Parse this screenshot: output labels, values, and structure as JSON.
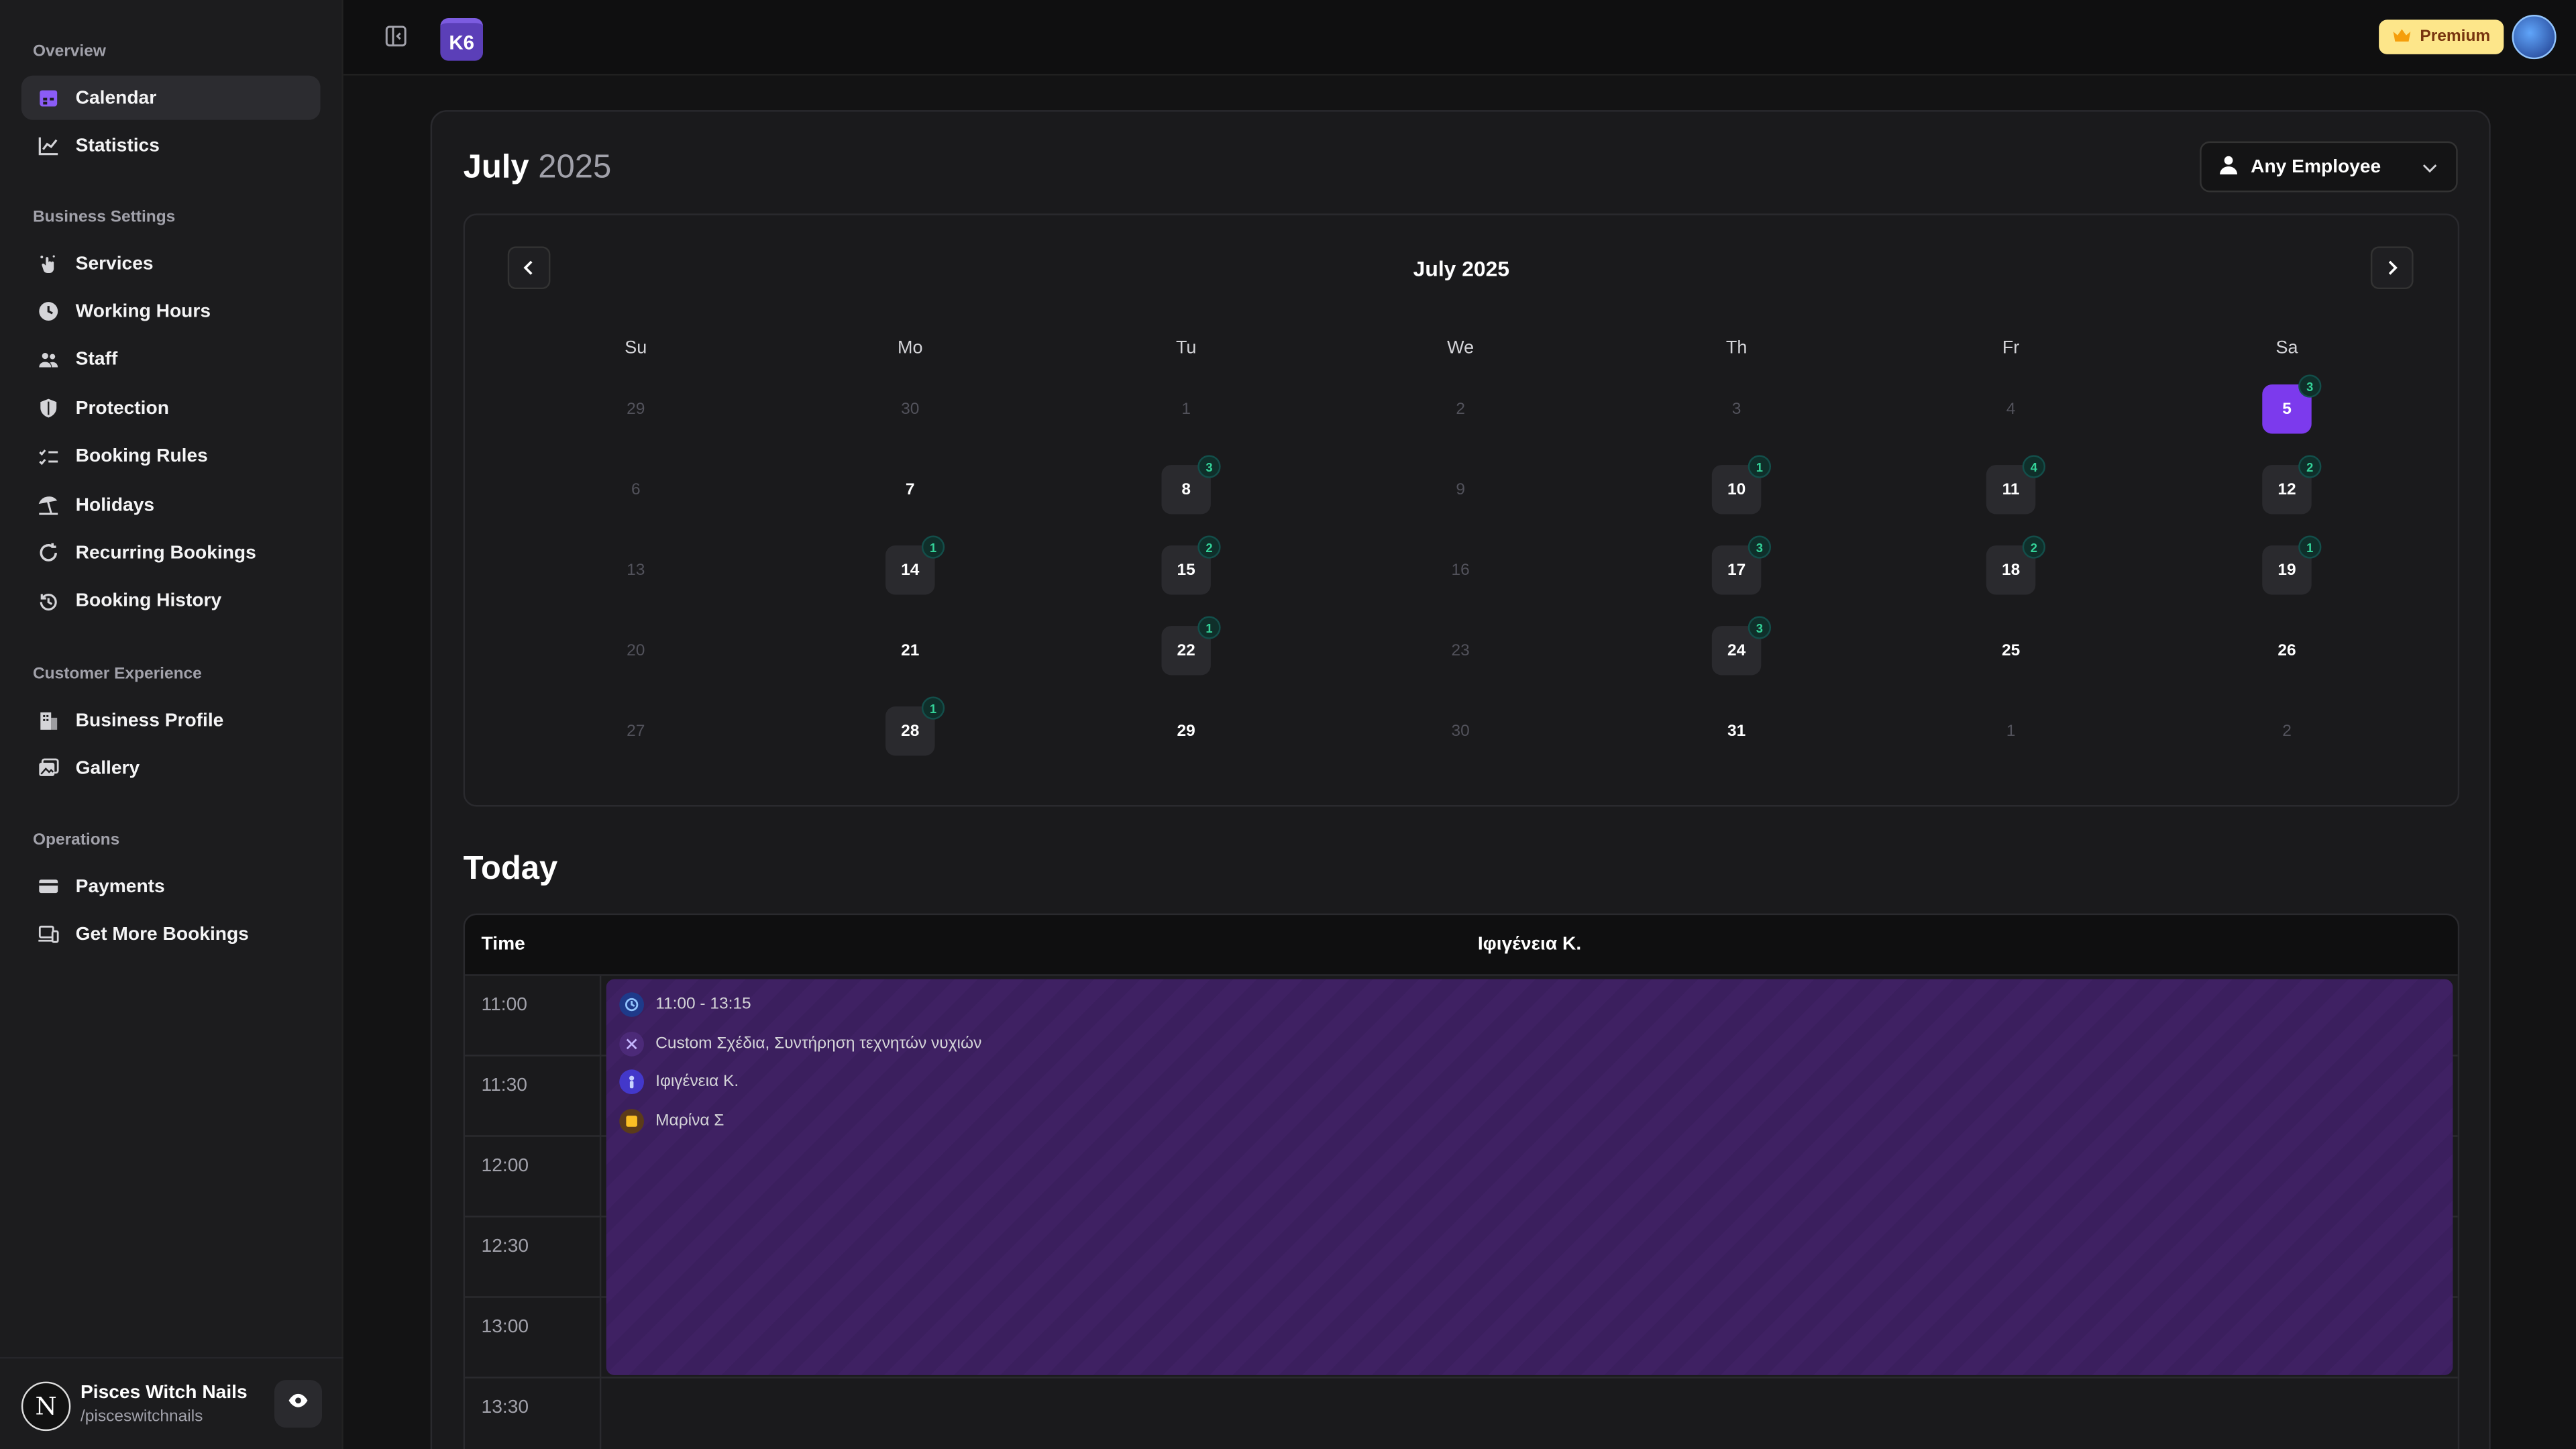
{
  "sidebar": {
    "sections": [
      {
        "heading": "Overview",
        "items": [
          {
            "label": "Calendar",
            "icon": "calendar-icon",
            "active": true
          },
          {
            "label": "Statistics",
            "icon": "chart-icon"
          }
        ]
      },
      {
        "heading": "Business Settings",
        "items": [
          {
            "label": "Services",
            "icon": "hand-sparkle-icon"
          },
          {
            "label": "Working Hours",
            "icon": "clock-icon"
          },
          {
            "label": "Staff",
            "icon": "users-icon"
          },
          {
            "label": "Protection",
            "icon": "shield-icon"
          },
          {
            "label": "Booking Rules",
            "icon": "list-check-icon"
          },
          {
            "label": "Holidays",
            "icon": "beach-icon"
          },
          {
            "label": "Recurring Bookings",
            "icon": "refresh-icon"
          },
          {
            "label": "Booking History",
            "icon": "history-icon"
          }
        ]
      },
      {
        "heading": "Customer Experience",
        "items": [
          {
            "label": "Business Profile",
            "icon": "building-icon"
          },
          {
            "label": "Gallery",
            "icon": "gallery-icon"
          }
        ]
      },
      {
        "heading": "Operations",
        "items": [
          {
            "label": "Payments",
            "icon": "credit-card-icon"
          },
          {
            "label": "Get More Bookings",
            "icon": "device-icon"
          }
        ]
      }
    ],
    "business": {
      "name": "Pisces Witch Nails",
      "handle": "/pisceswitchnails",
      "avatar_letter": "N"
    }
  },
  "topbar": {
    "logo_text": "K6",
    "premium_label": "Premium"
  },
  "page": {
    "month": "July",
    "year": "2025",
    "employee_select": "Any Employee"
  },
  "calendar": {
    "title": "July 2025",
    "weekdays": [
      "Su",
      "Mo",
      "Tu",
      "We",
      "Th",
      "Fr",
      "Sa"
    ],
    "weeks": [
      [
        {
          "d": "29",
          "muted": true
        },
        {
          "d": "30",
          "muted": true
        },
        {
          "d": "1",
          "muted": true
        },
        {
          "d": "2",
          "muted": true
        },
        {
          "d": "3",
          "muted": true
        },
        {
          "d": "4",
          "muted": true
        },
        {
          "d": "5",
          "selected": true,
          "count": "3"
        }
      ],
      [
        {
          "d": "6",
          "muted": true
        },
        {
          "d": "7"
        },
        {
          "d": "8",
          "count": "3"
        },
        {
          "d": "9",
          "muted": true
        },
        {
          "d": "10",
          "count": "1"
        },
        {
          "d": "11",
          "count": "4"
        },
        {
          "d": "12",
          "count": "2"
        }
      ],
      [
        {
          "d": "13",
          "muted": true
        },
        {
          "d": "14",
          "count": "1"
        },
        {
          "d": "15",
          "count": "2"
        },
        {
          "d": "16",
          "muted": true
        },
        {
          "d": "17",
          "count": "3"
        },
        {
          "d": "18",
          "count": "2"
        },
        {
          "d": "19",
          "count": "1"
        }
      ],
      [
        {
          "d": "20",
          "muted": true
        },
        {
          "d": "21"
        },
        {
          "d": "22",
          "count": "1"
        },
        {
          "d": "23",
          "muted": true
        },
        {
          "d": "24",
          "count": "3"
        },
        {
          "d": "25"
        },
        {
          "d": "26"
        }
      ],
      [
        {
          "d": "27",
          "muted": true
        },
        {
          "d": "28",
          "count": "1"
        },
        {
          "d": "29"
        },
        {
          "d": "30",
          "muted": true
        },
        {
          "d": "31"
        },
        {
          "d": "1",
          "muted": true
        },
        {
          "d": "2",
          "muted": true
        }
      ]
    ]
  },
  "today": {
    "title": "Today",
    "time_header": "Time",
    "employee": "Ιφιγένεια Κ.",
    "times": [
      "11:00",
      "11:30",
      "12:00",
      "12:30",
      "13:00",
      "13:30"
    ],
    "booking": {
      "time": "11:00 - 13:15",
      "services": "Custom Σχέδια, Συντήρηση τεχνητών νυχιών",
      "employee": "Ιφιγένεια Κ.",
      "customer": "Μαρίνα Σ"
    }
  },
  "colors": {
    "accent": "#7c3aed",
    "booking_bg": "#3b1f5e",
    "badge_text": "#34d399",
    "premium_bg": "#fde68a"
  }
}
